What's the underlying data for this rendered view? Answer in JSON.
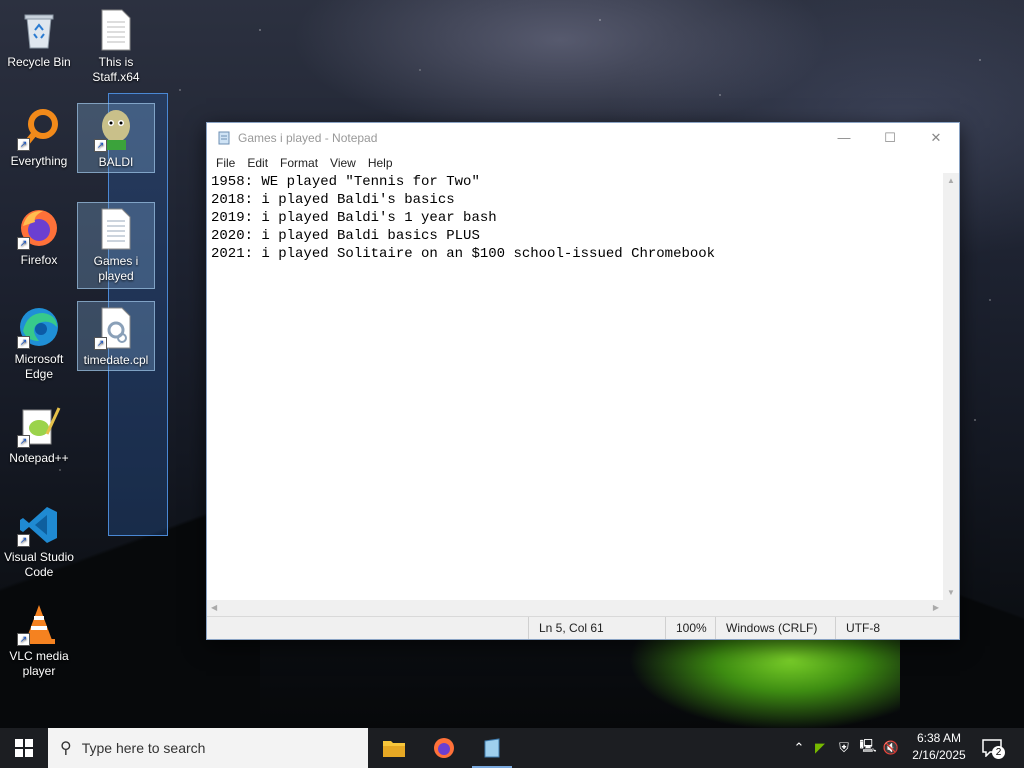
{
  "desktop": {
    "icons": [
      {
        "label": "Recycle Bin",
        "icon": "recycle-bin-icon"
      },
      {
        "label": "This is Staff.x64",
        "icon": "text-file-icon"
      },
      {
        "label": "Everything",
        "icon": "everything-search-icon"
      },
      {
        "label": "BALDI",
        "icon": "baldi-icon"
      },
      {
        "label": "Firefox",
        "icon": "firefox-icon"
      },
      {
        "label": "Games i played",
        "icon": "notepad-file-icon"
      },
      {
        "label": "Microsoft Edge",
        "icon": "edge-icon"
      },
      {
        "label": "timedate.cpl",
        "icon": "control-panel-file-icon"
      },
      {
        "label": "Notepad++",
        "icon": "notepadpp-icon"
      },
      {
        "label": "Visual Studio Code",
        "icon": "vscode-icon"
      },
      {
        "label": "VLC media player",
        "icon": "vlc-icon"
      }
    ]
  },
  "notepad": {
    "title": "Games i played - Notepad",
    "menu": [
      "File",
      "Edit",
      "Format",
      "View",
      "Help"
    ],
    "lines": [
      "1958: WE played \"Tennis for Two\"",
      "2018: i played Baldi's basics",
      "2019: i played Baldi's 1 year bash",
      "2020: i played Baldi basics PLUS",
      "2021: i played Solitaire on an $100 school-issued Chromebook"
    ],
    "status": {
      "position": "Ln 5, Col 61",
      "zoom": "100%",
      "line_ending": "Windows (CRLF)",
      "encoding": "UTF-8"
    }
  },
  "taskbar": {
    "search_placeholder": "Type here to search",
    "apps": [
      "file-explorer-icon",
      "firefox-icon",
      "notepad-icon"
    ],
    "time": "6:38 AM",
    "date": "2/16/2025",
    "notification_count": "2"
  },
  "colors": {
    "taskbar": "#1c1e22",
    "selection": "#4a88d4",
    "accent_underline": "#7aa9de"
  }
}
